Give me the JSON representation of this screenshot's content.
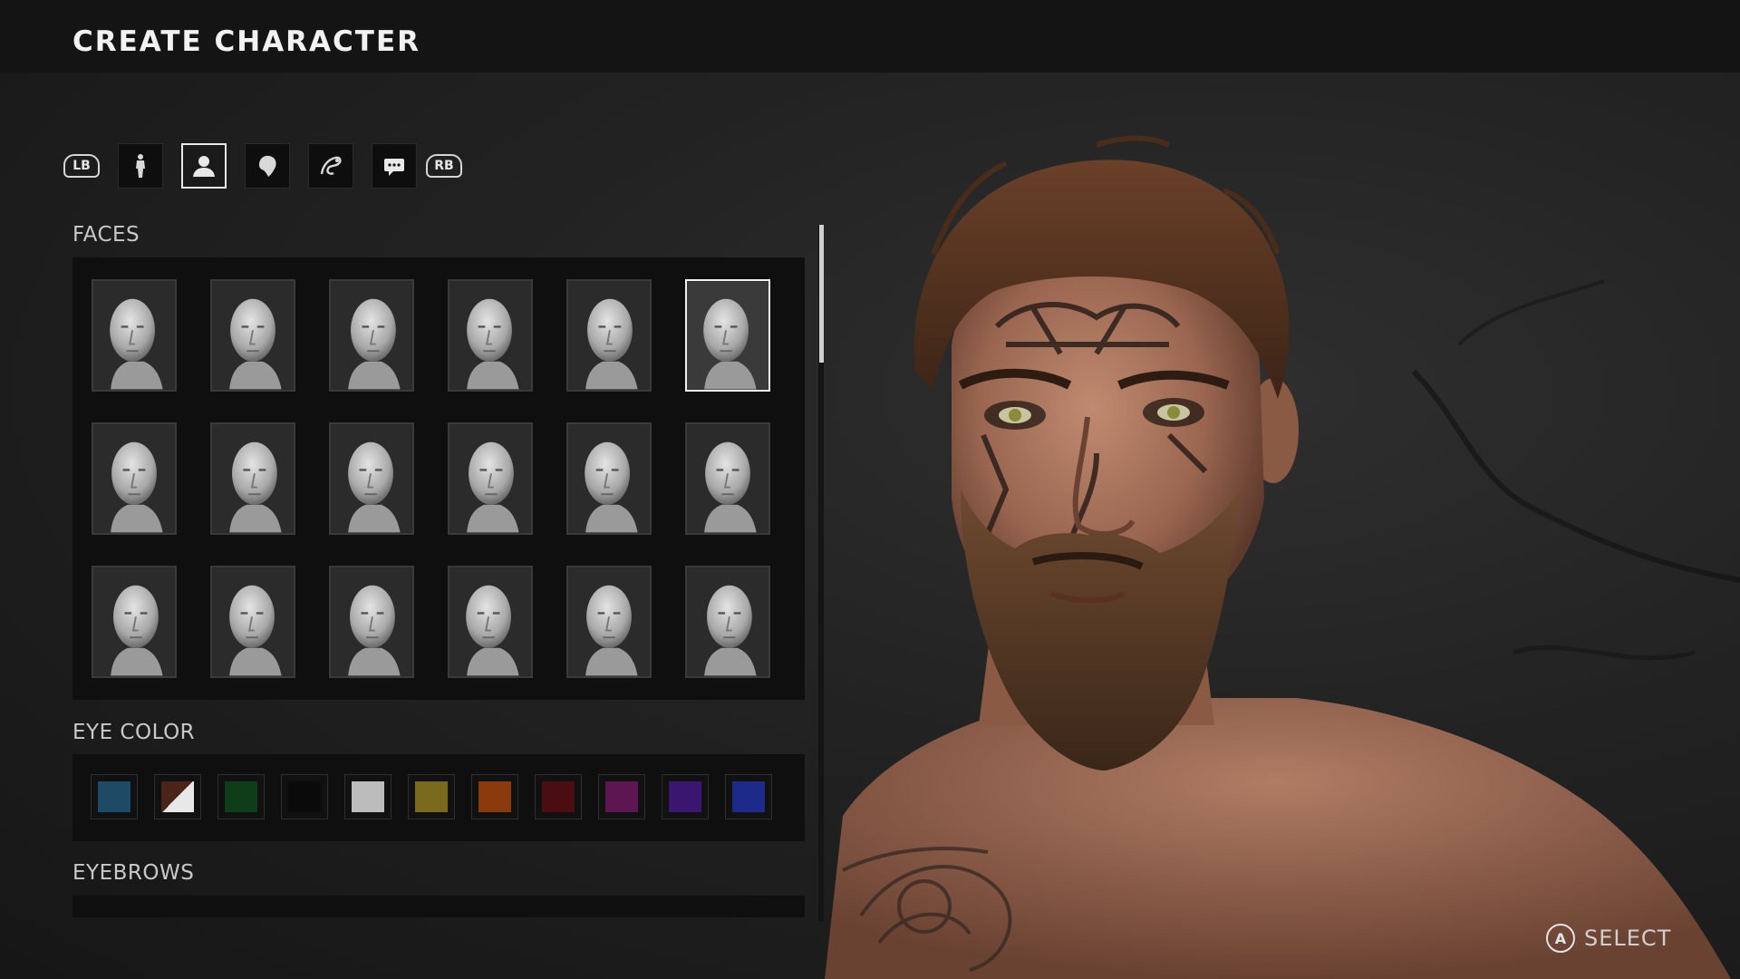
{
  "header": {
    "title": "CREATE CHARACTER"
  },
  "tabs": {
    "left_bumper": "LB",
    "right_bumper": "RB",
    "items": [
      {
        "icon": "body-icon",
        "active": false
      },
      {
        "icon": "head-icon",
        "active": true
      },
      {
        "icon": "hair-icon",
        "active": false
      },
      {
        "icon": "tattoo-icon",
        "active": false
      },
      {
        "icon": "chat-icon",
        "active": false
      }
    ]
  },
  "faces": {
    "label": "FACES",
    "count": 18,
    "selected_index": 5
  },
  "eye_color": {
    "label": "EYE COLOR",
    "swatches": [
      {
        "color": "#1f4a66"
      },
      {
        "color": "#4a2418",
        "selected": true
      },
      {
        "color": "#0f3d1a"
      },
      {
        "color": "#0a0a0a"
      },
      {
        "color": "#bcbcbc"
      },
      {
        "color": "#7a6a1e"
      },
      {
        "color": "#8a3a0c"
      },
      {
        "color": "#4a0e12"
      },
      {
        "color": "#5e1652"
      },
      {
        "color": "#3a1670"
      },
      {
        "color": "#1e2a8a"
      }
    ]
  },
  "eyebrows": {
    "label": "EYEBROWS"
  },
  "prompt": {
    "button": "A",
    "label": "SELECT"
  }
}
